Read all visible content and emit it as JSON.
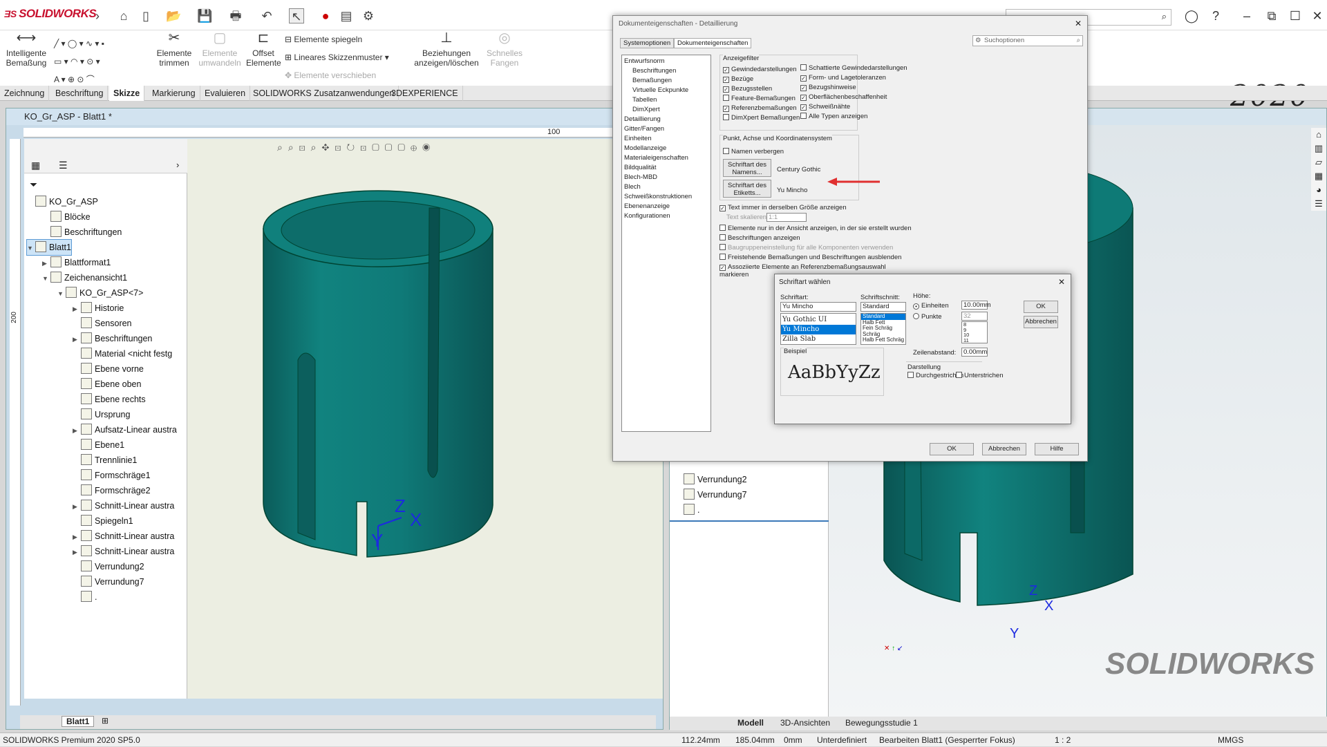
{
  "app": {
    "brand": "SOLIDWORKS",
    "version_badge": "2020",
    "status_text": "SOLIDWORKS Premium 2020 SP5.0"
  },
  "toolbar": {
    "smart_dim": "Intelligente Bemaßung",
    "trim": "Elemente trimmen",
    "convert": "Elemente umwandeln",
    "offset": "Offset Elemente",
    "mirror": "Elemente spiegeln",
    "linear_pattern": "Lineares Skizzenmuster",
    "move": "Elemente verschieben",
    "relations": "Beziehungen anzeigen/löschen",
    "rapid": "Schnelles Fangen"
  },
  "tabs": [
    "Zeichnung",
    "Beschriftung",
    "Skizze",
    "Markierung",
    "Evaluieren",
    "SOLIDWORKS Zusatzanwendungen",
    "3DEXPERIENCE"
  ],
  "active_tab": "Skizze",
  "left_window": {
    "title": "KO_Gr_ASP - Blatt1 *",
    "ruler_mark": "100",
    "vruler_mark": "200",
    "tree": [
      {
        "label": "KO_Gr_ASP",
        "indent": 0,
        "arrow": ""
      },
      {
        "label": "Blöcke",
        "indent": 1,
        "arrow": ""
      },
      {
        "label": "Beschriftungen",
        "indent": 1,
        "arrow": ""
      },
      {
        "label": "Blatt1",
        "indent": 0,
        "arrow": "▼",
        "selected": true
      },
      {
        "label": "Blattformat1",
        "indent": 1,
        "arrow": "▶"
      },
      {
        "label": "Zeichenansicht1",
        "indent": 1,
        "arrow": "▼"
      },
      {
        "label": "KO_Gr_ASP<7>",
        "indent": 2,
        "arrow": "▼"
      },
      {
        "label": "Historie",
        "indent": 3,
        "arrow": "▶"
      },
      {
        "label": "Sensoren",
        "indent": 3,
        "arrow": ""
      },
      {
        "label": "Beschriftungen",
        "indent": 3,
        "arrow": "▶"
      },
      {
        "label": "Material <nicht festg",
        "indent": 3,
        "arrow": ""
      },
      {
        "label": "Ebene vorne",
        "indent": 3,
        "arrow": ""
      },
      {
        "label": "Ebene oben",
        "indent": 3,
        "arrow": ""
      },
      {
        "label": "Ebene rechts",
        "indent": 3,
        "arrow": ""
      },
      {
        "label": "Ursprung",
        "indent": 3,
        "arrow": ""
      },
      {
        "label": "Aufsatz-Linear austra",
        "indent": 3,
        "arrow": "▶"
      },
      {
        "label": "Ebene1",
        "indent": 3,
        "arrow": ""
      },
      {
        "label": "Trennlinie1",
        "indent": 3,
        "arrow": ""
      },
      {
        "label": "Formschräge1",
        "indent": 3,
        "arrow": ""
      },
      {
        "label": "Formschräge2",
        "indent": 3,
        "arrow": ""
      },
      {
        "label": "Schnitt-Linear austra",
        "indent": 3,
        "arrow": "▶"
      },
      {
        "label": "Spiegeln1",
        "indent": 3,
        "arrow": ""
      },
      {
        "label": "Schnitt-Linear austra",
        "indent": 3,
        "arrow": "▶"
      },
      {
        "label": "Schnitt-Linear austra",
        "indent": 3,
        "arrow": "▶"
      },
      {
        "label": "Verrundung2",
        "indent": 3,
        "arrow": ""
      },
      {
        "label": "Verrundung7",
        "indent": 3,
        "arrow": ""
      },
      {
        "label": ".",
        "indent": 3,
        "arrow": ""
      }
    ],
    "sheet_tab": "Blatt1"
  },
  "right_window": {
    "tree": [
      {
        "label": "Verrundung2"
      },
      {
        "label": "Verrundung7"
      },
      {
        "label": "."
      }
    ],
    "bottom_tabs": [
      "Modell",
      "3D-Ansichten",
      "Bewegungsstudie 1"
    ],
    "active_bottom_tab": "Modell",
    "logo": "SOLIDWORKS"
  },
  "status_bar": {
    "x": "112.24mm",
    "y": "185.04mm",
    "z": "0mm",
    "state": "Unterdefiniert",
    "mode": "Bearbeiten Blatt1 (Gesperrter Fokus)",
    "scale": "1 : 2",
    "units": "MMGS"
  },
  "doc_dialog": {
    "title": "Dokumenteigenschaften - Detaillierung",
    "tab_system": "Systemoptionen",
    "tab_doc": "Dokumenteigenschaften",
    "search_placeholder": "Suchoptionen",
    "nav": [
      "Entwurfsnorm",
      "Beschriftungen",
      "Bemaßungen",
      "Virtuelle Eckpunkte",
      "Tabellen",
      "DimXpert",
      "Detaillierung",
      "Gitter/Fangen",
      "Einheiten",
      "Modellanzeige",
      "Materialeigenschaften",
      "Bildqualität",
      "Blech-MBD",
      "Blech",
      "Schweißkonstruktionen",
      "Ebenenanzeige",
      "Konfigurationen"
    ],
    "filter_title": "Anzeigefilter",
    "filters_left": [
      {
        "label": "Gewindedarstellungen",
        "checked": true
      },
      {
        "label": "Bezüge",
        "checked": true
      },
      {
        "label": "Bezugsstellen",
        "checked": true
      },
      {
        "label": "Feature-Bemaßungen",
        "checked": false
      },
      {
        "label": "Referenzbemaßungen",
        "checked": true
      },
      {
        "label": "DimXpert Bemaßungen",
        "checked": false
      }
    ],
    "filters_right": [
      {
        "label": "Schattierte Gewindedarstellungen",
        "checked": false
      },
      {
        "label": "Form- und Lagetoleranzen",
        "checked": true
      },
      {
        "label": "Bezugshinweise",
        "checked": true
      },
      {
        "label": "Oberflächenbeschaffenheit",
        "checked": true
      },
      {
        "label": "Schweißnähte",
        "checked": true
      },
      {
        "label": "Alle Typen anzeigen",
        "checked": false
      }
    ],
    "coord_title": "Punkt, Achse und Koordinatensystem",
    "hide_names": "Namen verbergen",
    "font_name_btn": "Schriftart des Namens...",
    "font_name_value": "Century Gothic",
    "font_label_btn": "Schriftart des Etiketts...",
    "font_label_value": "Yu Mincho",
    "same_size": "Text immer in derselben Größe anzeigen",
    "text_scale_label": "Text skalieren:",
    "text_scale_value": "1:1",
    "opt1": "Elemente nur in der Ansicht anzeigen, in der sie erstellt wurden",
    "opt2": "Beschriftungen anzeigen",
    "opt3": "Baugruppeneinstellung für alle Komponenten verwenden",
    "opt4": "Freistehende Bemaßungen und Beschriftungen ausblenden",
    "opt5": "Assoziierte Elemente an Referenzbemaßungsauswahl markieren",
    "ok": "OK",
    "cancel": "Abbrechen",
    "help": "Hilfe"
  },
  "font_dialog": {
    "title": "Schriftart wählen",
    "font_label": "Schriftart:",
    "font_value": "Yu Mincho",
    "fonts": [
      "Yu Gothic UI",
      "Yu Mincho",
      "Zilla Slab"
    ],
    "style_label": "Schriftschnitt:",
    "style_value": "Standard",
    "styles": [
      "Standard",
      "Halb Fett",
      "Fein Schräg",
      "Schräg",
      "Halb Fett Schräg"
    ],
    "height_label": "Höhe:",
    "units_label": "Einheiten",
    "units_value": "10.00mm",
    "points_label": "Punkte",
    "points_value": "32",
    "sizes": [
      "8",
      "9",
      "10",
      "11"
    ],
    "spacing_label": "Zeilenabstand:",
    "spacing_value": "0.00mm",
    "sample_label": "Beispiel",
    "sample_text": "AaBbYyZz",
    "effects_label": "Darstellung",
    "strike": "Durchgestrichen",
    "underline": "Unterstrichen",
    "ok": "OK",
    "cancel": "Abbrechen"
  },
  "colors": {
    "model": "#0f7a78",
    "accent": "#0078d7",
    "brand": "#c8102e"
  }
}
